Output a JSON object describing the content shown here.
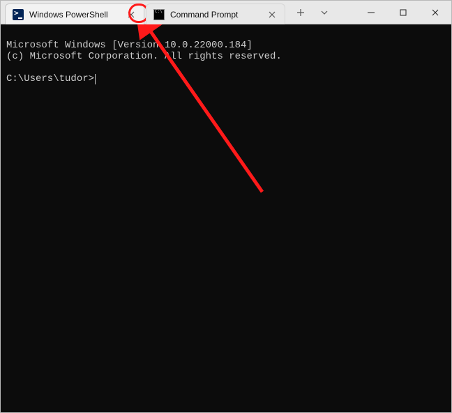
{
  "tabs": [
    {
      "title": "Windows PowerShell",
      "icon": "powershell"
    },
    {
      "title": "Command Prompt",
      "icon": "cmd"
    }
  ],
  "terminal": {
    "line1": "Microsoft Windows [Version 10.0.22000.184]",
    "line2": "(c) Microsoft Corporation. All rights reserved.",
    "blank": "",
    "prompt": "C:\\Users\\tudor>"
  }
}
